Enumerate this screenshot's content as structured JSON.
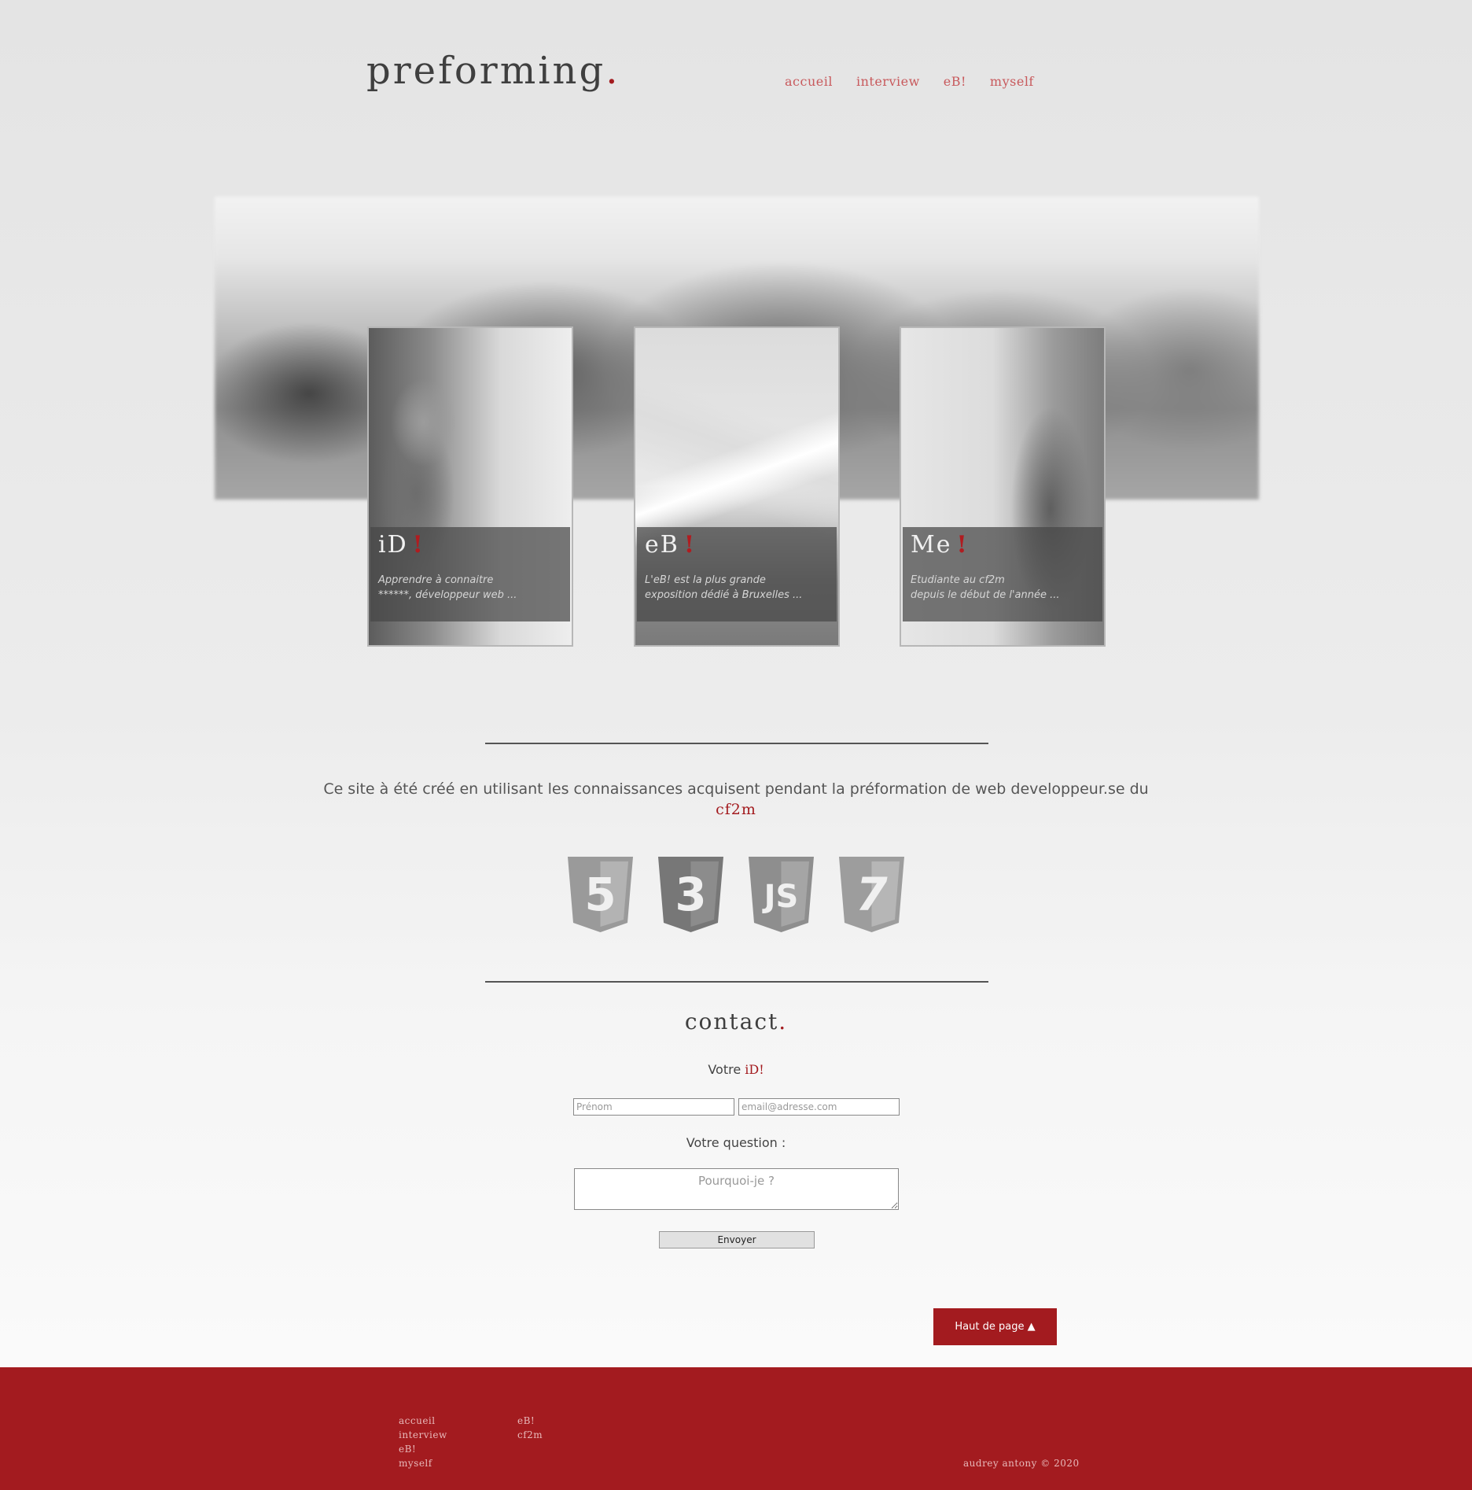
{
  "header": {
    "logo": "preforming",
    "logo_dot": ".",
    "nav": [
      "accueil",
      "interview",
      "eB!",
      "myself"
    ]
  },
  "cards": [
    {
      "title": "iD",
      "bang": "!",
      "line1": "Apprendre à connaitre",
      "line2": "******, développeur web ..."
    },
    {
      "title": "eB",
      "bang": "!",
      "line1": "L'eB! est la plus grande",
      "line2": "exposition dédié à Bruxelles ..."
    },
    {
      "title": "Me",
      "bang": "!",
      "line1": "Etudiante au cf2m",
      "line2": "depuis le début de l'année ..."
    }
  ],
  "credit": {
    "text": "Ce site à été créé en utilisant les connaissances acquisent pendant la préformation de web developpeur.se du",
    "brand": "cf2m"
  },
  "techs": [
    {
      "icon": "html5-icon",
      "glyph": "5"
    },
    {
      "icon": "css3-icon",
      "glyph": "3"
    },
    {
      "icon": "javascript-icon",
      "glyph": "JS"
    },
    {
      "icon": "php7-icon",
      "glyph": "7"
    }
  ],
  "contact": {
    "title": "contact",
    "title_dot": ".",
    "votre": "Votre",
    "id": "iD!",
    "prenom_placeholder": "Prénom",
    "email_placeholder": "email@adresse.com",
    "question_label": "Votre question :",
    "question_placeholder": "Pourquoi-je ?",
    "send": "Envoyer"
  },
  "back_to_top": "Haut de page ▲",
  "footer": {
    "col1": [
      "accueil",
      "interview",
      "eB!",
      "myself"
    ],
    "col2": [
      "eB!",
      "cf2m"
    ],
    "copyright": "audrey antony © 2020"
  },
  "colors": {
    "accent": "#a31b1f",
    "nav": "#c8595c"
  }
}
